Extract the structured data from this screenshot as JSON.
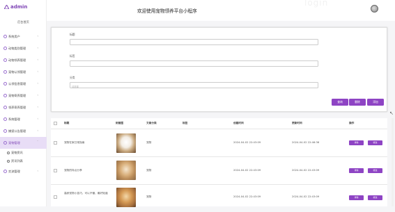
{
  "app": {
    "logo_text": "admin",
    "home_label": "后台首页",
    "page_title": "欢迎使用宠物领养平台小程序",
    "bg_watermark": "login"
  },
  "sidebar": {
    "items": [
      {
        "label": "系统用户"
      },
      {
        "label": "动物类别管理"
      },
      {
        "label": "动物领养管理"
      },
      {
        "label": "宠物认领管理"
      },
      {
        "label": "认领信息管理"
      },
      {
        "label": "宠物寄养管理"
      },
      {
        "label": "领养寄养管理"
      },
      {
        "label": "系统管理"
      },
      {
        "label": "捕捉公告管理"
      },
      {
        "label": "宠物管理"
      },
      {
        "label": "交流管理"
      }
    ],
    "subitems": [
      {
        "label": "宠物资讯"
      },
      {
        "label": "资讯列表"
      }
    ]
  },
  "filter": {
    "title_label": "标题",
    "tag_label": "标签",
    "category_label": "分类",
    "category_placeholder": "请选择"
  },
  "actions": {
    "query": "查询",
    "delete": "删除",
    "add": "添加"
  },
  "table": {
    "headers": [
      "标题",
      "封面图",
      "文章分类",
      "标签",
      "创建时间",
      "更新时间",
      "操作"
    ],
    "rows": [
      {
        "title": "宠物在家日常指南",
        "category": "宠物",
        "created": "2024-04-02 22:43:09",
        "updated": "2024-04-02 22:46:36",
        "detail": "详情",
        "edit": "修改",
        "review": "查看评论"
      },
      {
        "title": "宠物的特点分享",
        "category": "宠物",
        "created": "2024-04-02 22:43:09",
        "updated": "2024-04-02 22:43:09",
        "detail": "详情",
        "edit": "修改",
        "review": "查看评论"
      },
      {
        "title": "高龄宠物小技巧，可以不懂，最好知道",
        "category": "宠物",
        "created": "2024-04-02 22:43:09",
        "updated": "2024-04-02 22:43:09",
        "detail": "详情",
        "edit": "修改",
        "review": "查看评论"
      }
    ]
  },
  "colors": {
    "accent": "#8e44c4",
    "active_bg": "#e8ddf6"
  }
}
